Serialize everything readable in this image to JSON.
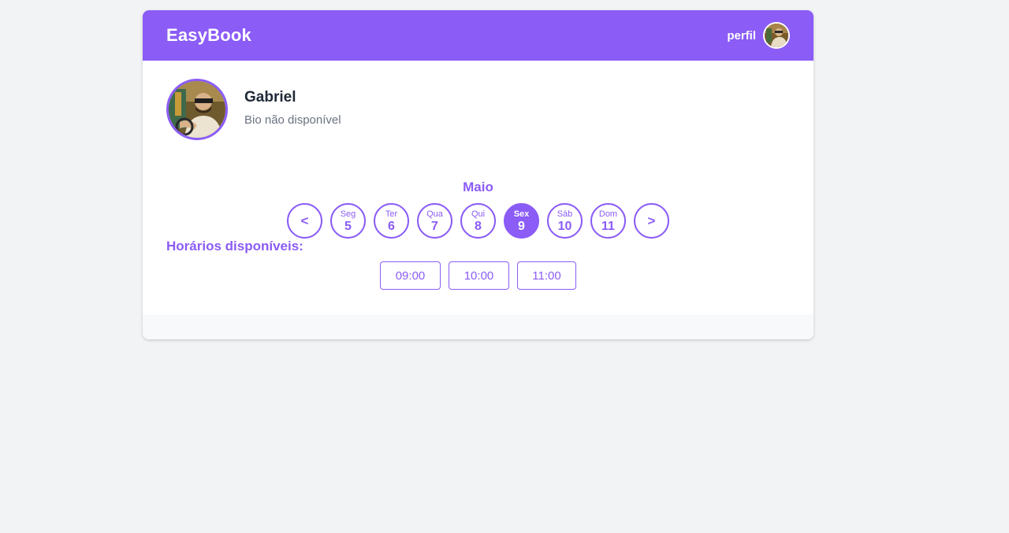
{
  "app": {
    "brand": "EasyBook",
    "profile_label": "perfil"
  },
  "user": {
    "name": "Gabriel",
    "bio": "Bio não disponível"
  },
  "calendar": {
    "month": "Maio",
    "prev_label": "<",
    "next_label": ">",
    "days": [
      {
        "name": "Seg",
        "num": "5",
        "selected": false
      },
      {
        "name": "Ter",
        "num": "6",
        "selected": false
      },
      {
        "name": "Qua",
        "num": "7",
        "selected": false
      },
      {
        "name": "Qui",
        "num": "8",
        "selected": false
      },
      {
        "name": "Sex",
        "num": "9",
        "selected": true
      },
      {
        "name": "Sáb",
        "num": "10",
        "selected": false
      },
      {
        "name": "Dom",
        "num": "11",
        "selected": false
      }
    ]
  },
  "availability": {
    "title": "Horários disponíveis:",
    "slots": [
      "09:00",
      "10:00",
      "11:00"
    ]
  },
  "colors": {
    "accent": "#8b5cf6",
    "background": "#f2f3f5",
    "text_dark": "#1f2937",
    "text_muted": "#6b7280"
  }
}
